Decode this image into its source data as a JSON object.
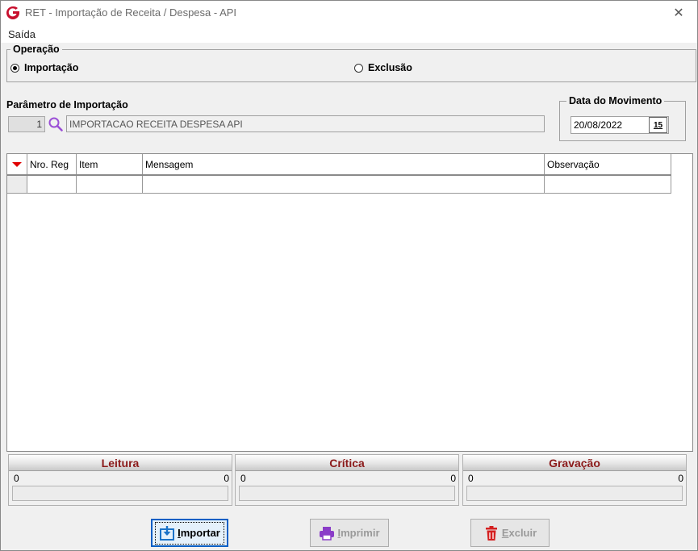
{
  "window": {
    "title": "RET - Importação de Receita / Despesa - API",
    "close_label": "✕"
  },
  "menu": {
    "items": [
      {
        "label": "Saída"
      }
    ]
  },
  "operacao": {
    "legend": "Operação",
    "options": [
      {
        "label": "Importação",
        "selected": true
      },
      {
        "label": "Exclusão",
        "selected": false
      }
    ]
  },
  "parametro": {
    "label": "Parâmetro de Importação",
    "code": "1",
    "description": "IMPORTACAO RECEITA DESPESA API"
  },
  "data_movimento": {
    "legend": "Data do Movimento",
    "value": "20/08/2022",
    "calendar_label": "15"
  },
  "grid": {
    "columns": [
      {
        "label": "Nro. Reg"
      },
      {
        "label": "Item"
      },
      {
        "label": "Mensagem"
      },
      {
        "label": "Observação"
      }
    ]
  },
  "counters": [
    {
      "title": "Leitura",
      "left": "0",
      "right": "0"
    },
    {
      "title": "Crítica",
      "left": "0",
      "right": "0"
    },
    {
      "title": "Gravação",
      "left": "0",
      "right": "0"
    }
  ],
  "buttons": {
    "importar": {
      "first": "I",
      "rest": "mportar"
    },
    "imprimir": {
      "first": "I",
      "rest": "mprimir"
    },
    "excluir": {
      "first": "E",
      "rest": "xcluir"
    }
  },
  "colors": {
    "counter_title": "#8b1a1a",
    "sort_indicator": "#e00000",
    "focus_border": "#0a5fc4",
    "print_icon": "#8a3cc8",
    "delete_icon": "#d42020",
    "import_icon": "#1a73c8"
  }
}
